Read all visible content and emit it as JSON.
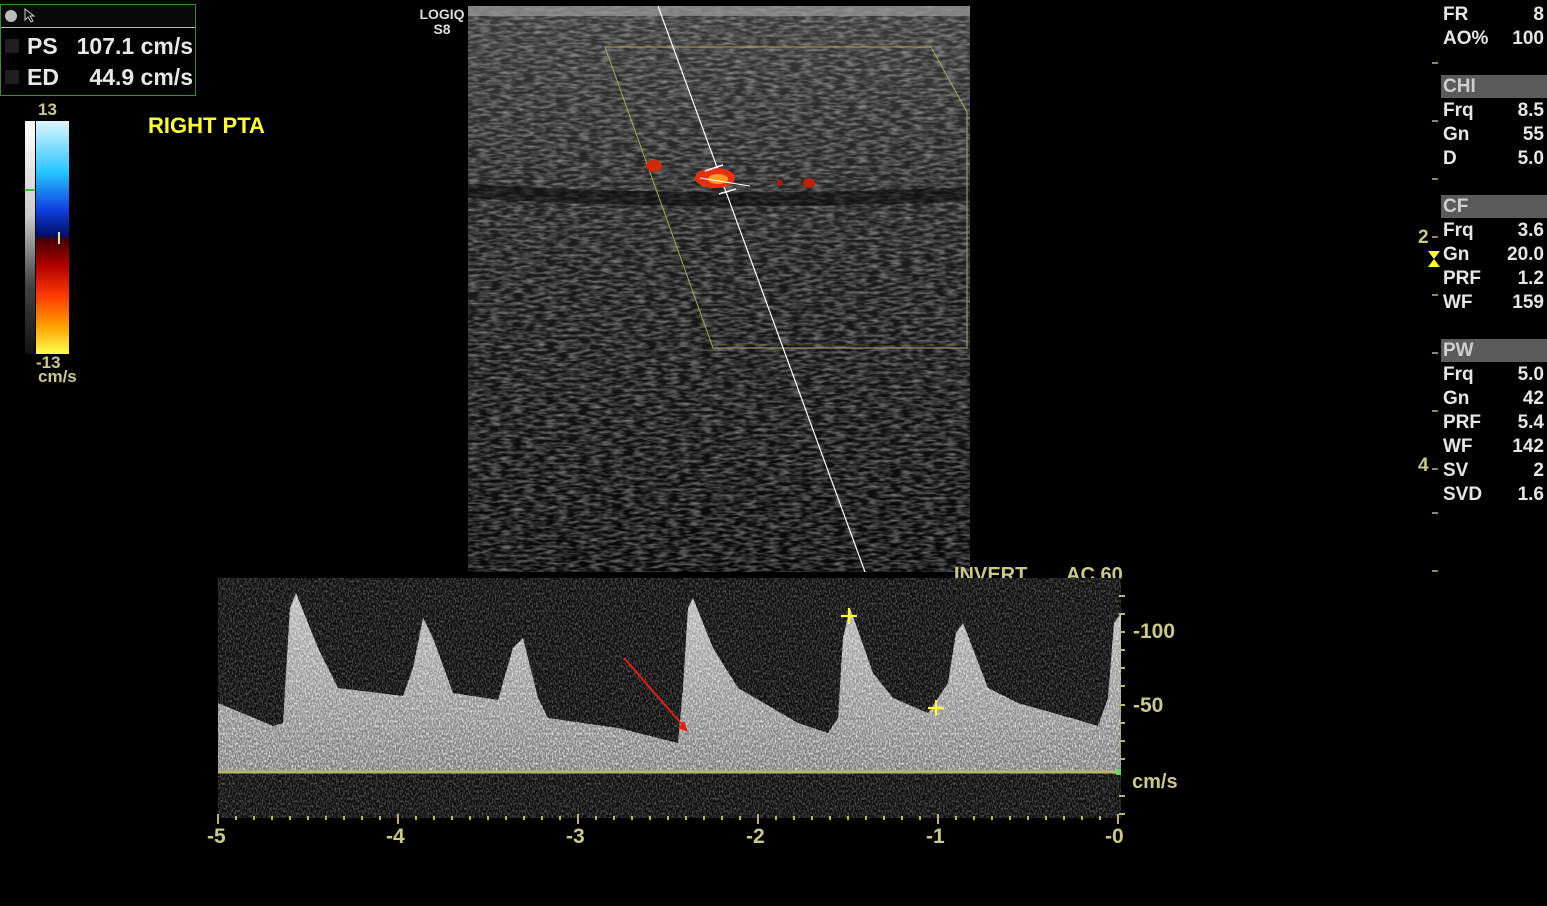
{
  "device": {
    "brand": "LOGIQ",
    "model": "S8"
  },
  "measurements": [
    {
      "label": "PS",
      "value": "107.1 cm/s"
    },
    {
      "label": "ED",
      "value": "44.9 cm/s"
    }
  ],
  "annotation": "RIGHT PTA",
  "color_scale": {
    "top": "13",
    "bottom": "-13",
    "unit": "cm/s"
  },
  "params": {
    "general": [
      {
        "k": "FR",
        "v": "8"
      },
      {
        "k": "AO%",
        "v": "100"
      }
    ],
    "chi": {
      "title": "CHI",
      "items": [
        {
          "k": "Frq",
          "v": "8.5"
        },
        {
          "k": "Gn",
          "v": "55"
        },
        {
          "k": "D",
          "v": "5.0"
        }
      ]
    },
    "cf": {
      "title": "CF",
      "items": [
        {
          "k": "Frq",
          "v": "3.6"
        },
        {
          "k": "Gn",
          "v": "20.0"
        },
        {
          "k": "PRF",
          "v": "1.2"
        },
        {
          "k": "WF",
          "v": "159"
        }
      ]
    },
    "pw": {
      "title": "PW",
      "items": [
        {
          "k": "Frq",
          "v": "5.0"
        },
        {
          "k": "Gn",
          "v": "42"
        },
        {
          "k": "PRF",
          "v": "5.4"
        },
        {
          "k": "WF",
          "v": "142"
        },
        {
          "k": "SV",
          "v": "2"
        },
        {
          "k": "SVD",
          "v": "1.6"
        }
      ]
    }
  },
  "depth_markers": [
    "2",
    "4"
  ],
  "spectral": {
    "invert": "INVERT",
    "ac": "AC 60",
    "unit": "cm/s",
    "y_ticks": [
      "-100",
      "-50"
    ],
    "x_ticks": [
      "-5",
      "-4",
      "-3",
      "-2",
      "-1",
      "-0"
    ]
  },
  "colors": {
    "scale_text": "#c9c98a",
    "label_yellow": "#ffff30",
    "baseline": "#b8b86a",
    "header_bg": "#5b5b5b",
    "doppler_red": "#e02010"
  }
}
